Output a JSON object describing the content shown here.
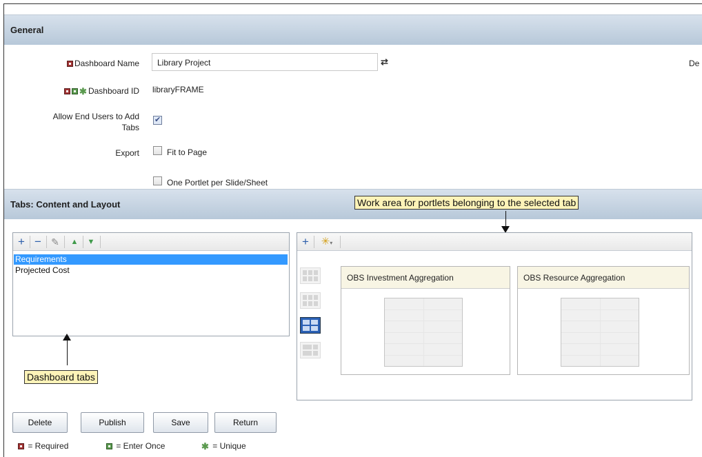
{
  "general": {
    "section_title": "General",
    "dashboard_name_label": "Dashboard Name",
    "dashboard_name_value": "Library Project",
    "cut_off_text": "De",
    "dashboard_id_label": "Dashboard ID",
    "dashboard_id_value": "libraryFRAME",
    "allow_tabs_label_line1": "Allow End Users to Add",
    "allow_tabs_label_line2": "Tabs",
    "allow_tabs_checked": true,
    "export_label": "Export",
    "fit_to_page_label": "Fit to Page",
    "one_portlet_label": "One Portlet per Slide/Sheet"
  },
  "tabs_section": {
    "title": "Tabs: Content and Layout",
    "tabs": [
      {
        "label": "Requirements",
        "selected": true
      },
      {
        "label": "Projected Cost",
        "selected": false
      }
    ],
    "tab_toolbar_icons": [
      "add-icon",
      "remove-icon",
      "edit-pencil-icon",
      "move-up-icon",
      "move-down-icon"
    ],
    "work_toolbar_icons": [
      "add-icon",
      "asterisk-dropdown-icon"
    ]
  },
  "annotations": {
    "work_area": "Work area for portlets belonging to the selected tab",
    "dashboard_tabs": "Dashboard tabs"
  },
  "portlets": [
    {
      "title": "OBS Investment Aggregation"
    },
    {
      "title": "OBS Resource Aggregation"
    }
  ],
  "buttons": {
    "delete": "Delete",
    "publish": "Publish",
    "save": "Save",
    "return": "Return"
  },
  "legend": {
    "required": "= Required",
    "enter_once": "= Enter Once",
    "unique": "= Unique"
  },
  "colors": {
    "required_icon": "#a23333",
    "enter_once_icon": "#5b9a4f",
    "selected_row": "#3399ff",
    "callout_bg": "#fdf3b8"
  }
}
